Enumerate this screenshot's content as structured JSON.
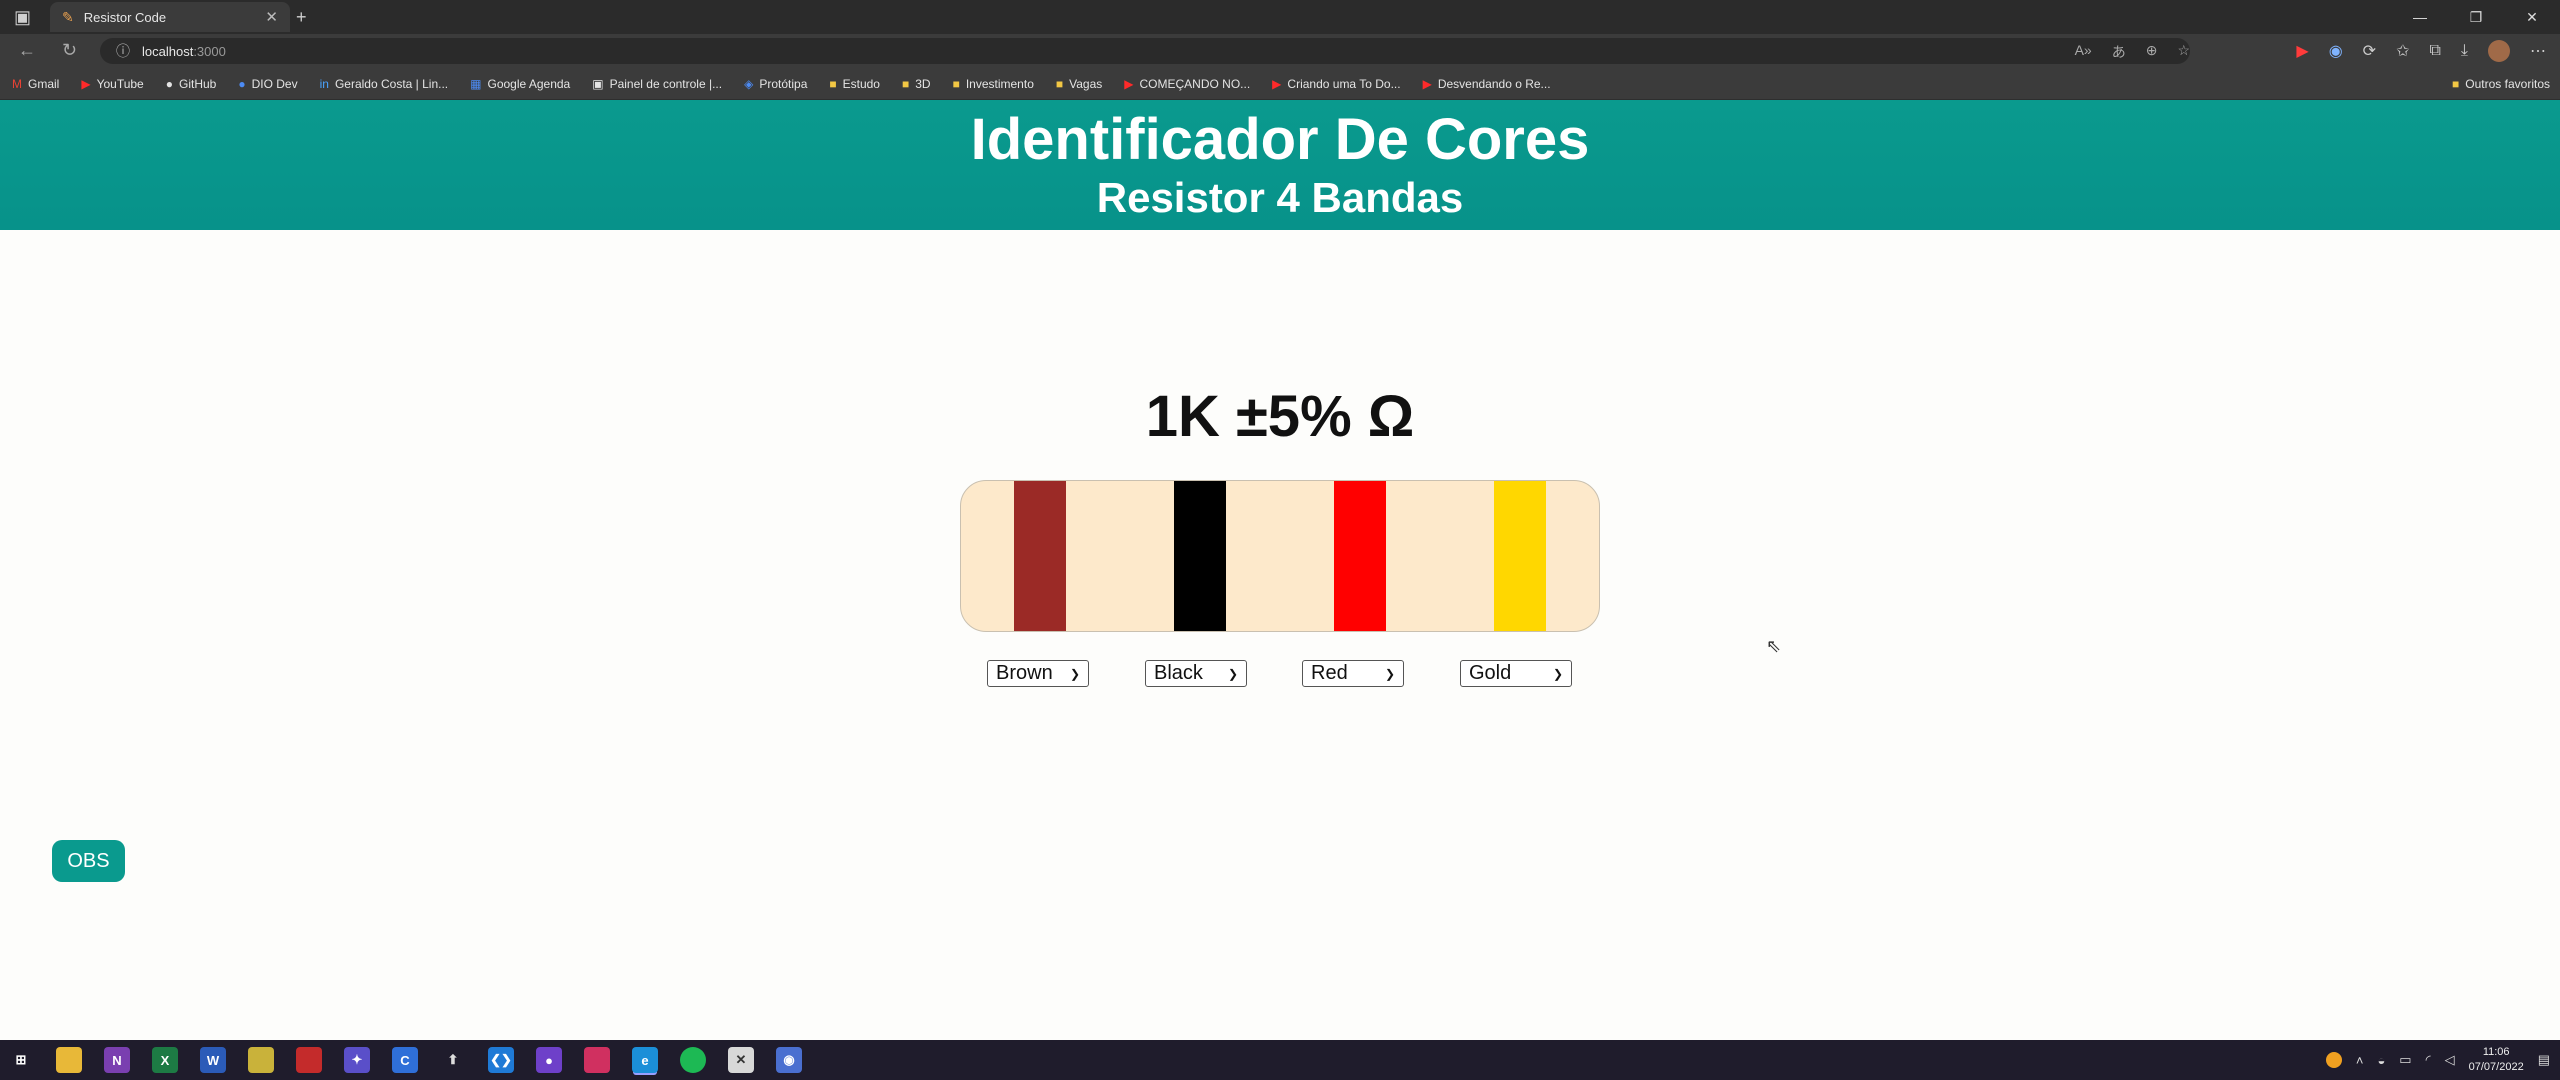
{
  "browser": {
    "tab_title": "Resistor Code",
    "url_host": "localhost",
    "url_port": ":3000",
    "bookmarks": [
      {
        "label": "Gmail",
        "icon": "gmail-icon"
      },
      {
        "label": "YouTube",
        "icon": "youtube-icon"
      },
      {
        "label": "GitHub",
        "icon": "github-icon"
      },
      {
        "label": "DIO Dev",
        "icon": "dio-icon"
      },
      {
        "label": "Geraldo Costa | Lin...",
        "icon": "linkedin-icon"
      },
      {
        "label": "Google Agenda",
        "icon": "calendar-icon"
      },
      {
        "label": "Painel de controle |...",
        "icon": "panel-icon"
      },
      {
        "label": "Protótipa",
        "icon": "prototipa-icon"
      },
      {
        "label": "Estudo",
        "icon": "folder-icon"
      },
      {
        "label": "3D",
        "icon": "folder-icon"
      },
      {
        "label": "Investimento",
        "icon": "folder-icon"
      },
      {
        "label": "Vagas",
        "icon": "folder-icon"
      },
      {
        "label": "COMEÇANDO NO...",
        "icon": "youtube-icon"
      },
      {
        "label": "Criando uma To Do...",
        "icon": "youtube-icon"
      },
      {
        "label": "Desvendando o Re...",
        "icon": "youtube-icon"
      }
    ],
    "other_favorites": "Outros favoritos"
  },
  "page": {
    "title": "Identificador De Cores",
    "subtitle": "Resistor 4 Bandas",
    "resistance_value": "1K ±5% Ω",
    "bands": [
      {
        "name": "Brown",
        "color": "#9b2a26"
      },
      {
        "name": "Black",
        "color": "#000000"
      },
      {
        "name": "Red",
        "color": "#ff0000"
      },
      {
        "name": "Gold",
        "color": "#ffd700"
      }
    ],
    "selects": [
      "Brown",
      "Black",
      "Red",
      "Gold"
    ],
    "obs_button": "OBS",
    "colors": {
      "header": "#0a9a8e",
      "resistor_body": "#fde9cb"
    }
  },
  "taskbar": {
    "time": "11:06",
    "date": "07/07/2022"
  }
}
